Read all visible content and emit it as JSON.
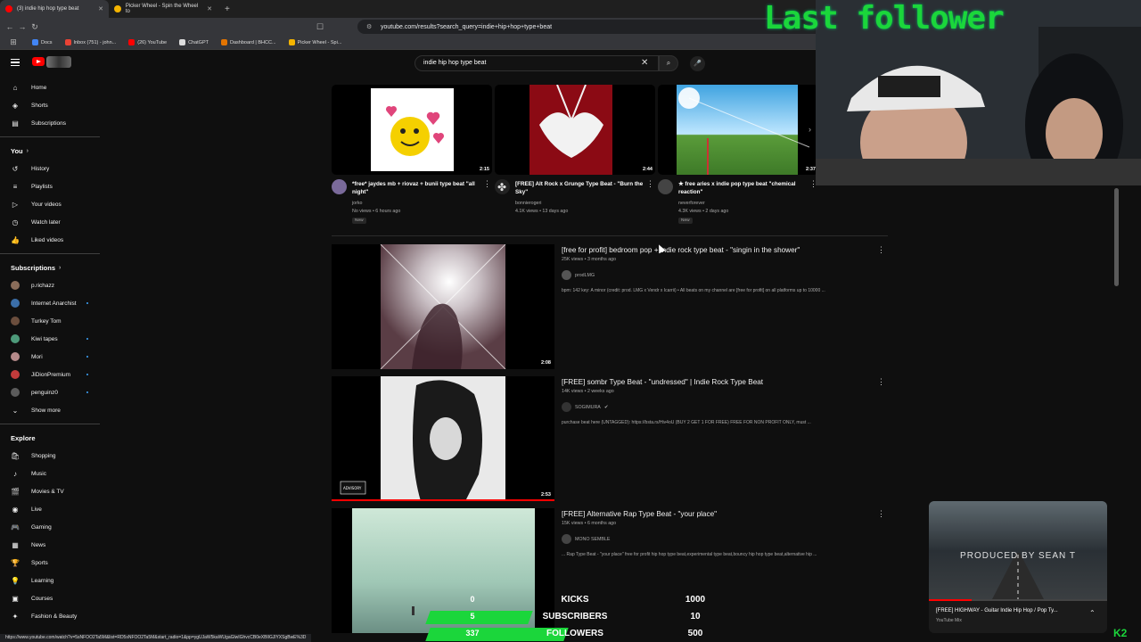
{
  "browser": {
    "tabs": [
      {
        "label": "(3) indie hip hop type beat",
        "color": "#ff0000"
      },
      {
        "label": "Picker Wheel - Spin the Wheel to",
        "color": "#f4b400"
      }
    ],
    "url": "youtube.com/results?search_query=indie+hip+hop+type+beat",
    "bookmarks": [
      "Docs",
      "Inbox (751) - john...",
      "(26) YouTube",
      "ChatGPT",
      "Dashboard | BHCC...",
      "Picker Wheel - Spi..."
    ]
  },
  "youtube": {
    "search_query": "indie hip hop type beat"
  },
  "sidebar": {
    "main": [
      {
        "label": "Home",
        "icon": "home-icon",
        "glyph": "⌂"
      },
      {
        "label": "Shorts",
        "icon": "shorts-icon",
        "glyph": "◈"
      },
      {
        "label": "Subscriptions",
        "icon": "subscriptions-icon",
        "glyph": "▤"
      }
    ],
    "you_heading": "You",
    "you": [
      {
        "label": "History",
        "icon": "history-icon",
        "glyph": "↺"
      },
      {
        "label": "Playlists",
        "icon": "playlists-icon",
        "glyph": "≡"
      },
      {
        "label": "Your videos",
        "icon": "your-videos-icon",
        "glyph": "▷"
      },
      {
        "label": "Watch later",
        "icon": "watch-later-icon",
        "glyph": "◷"
      },
      {
        "label": "Liked videos",
        "icon": "liked-videos-icon",
        "glyph": "👍"
      }
    ],
    "subs_heading": "Subscriptions",
    "subs": [
      {
        "label": "p.richazz",
        "color": "#8a6d5a",
        "dot": false
      },
      {
        "label": "Internet Anarchist",
        "color": "#3b6ea8",
        "dot": true
      },
      {
        "label": "Turkey Tom",
        "color": "#6b4e3d",
        "dot": false
      },
      {
        "label": "Kiwi tapes",
        "color": "#4d9a7a",
        "dot": true
      },
      {
        "label": "Mori",
        "color": "#b58a8a",
        "dot": true
      },
      {
        "label": "JiDionPremium",
        "color": "#c23b3b",
        "dot": true
      },
      {
        "label": "penguinz0",
        "color": "#5c5c5c",
        "dot": true
      }
    ],
    "show_more": "Show more",
    "explore_heading": "Explore",
    "explore": [
      {
        "label": "Shopping",
        "icon": "shopping-icon",
        "glyph": "🛍"
      },
      {
        "label": "Music",
        "icon": "music-icon",
        "glyph": "♪"
      },
      {
        "label": "Movies & TV",
        "icon": "movies-icon",
        "glyph": "🎬"
      },
      {
        "label": "Live",
        "icon": "live-icon",
        "glyph": "◉"
      },
      {
        "label": "Gaming",
        "icon": "gaming-icon",
        "glyph": "🎮"
      },
      {
        "label": "News",
        "icon": "news-icon",
        "glyph": "▦"
      },
      {
        "label": "Sports",
        "icon": "sports-icon",
        "glyph": "🏆"
      },
      {
        "label": "Learning",
        "icon": "learning-icon",
        "glyph": "💡"
      },
      {
        "label": "Courses",
        "icon": "courses-icon",
        "glyph": "▣"
      },
      {
        "label": "Fashion & Beauty",
        "icon": "fashion-icon",
        "glyph": "✦"
      }
    ]
  },
  "shorts": [
    {
      "title": "*free* jaydes mb + riovaz + bunii type beat \"all night\"",
      "channel": "jorko",
      "meta": "No views • 6 hours ago",
      "duration": "2:15",
      "badge": "New",
      "avatar": "#7a6a9a"
    },
    {
      "title": "[FREE] Alt Rock x Grunge Type Beat - \"Burn the Sky\"",
      "channel": "bonnierogeri",
      "meta": "4.1K views • 13 days ago",
      "duration": "2:44",
      "badge": "",
      "avatar": "#222222"
    },
    {
      "title": "★ free aries x indie pop type beat \"chemical reaction\"",
      "channel": "neverforever",
      "meta": "4.3K views • 2 days ago",
      "duration": "2:37",
      "badge": "New",
      "avatar": "#444444"
    }
  ],
  "videos": [
    {
      "title": "[free for profit] bedroom pop + indie rock type beat - \"singin in the shower\"",
      "meta": "25K views • 3 months ago",
      "channel": "prodLMG",
      "verified": false,
      "duration": "2:08",
      "desc": "bpm: 142 key: A minor (credit: prod. LMG x Vendr x Icarrii) • All beats on my channel are [free for profit] on all platforms up to 10000 ...",
      "avatar": "#555555"
    },
    {
      "title": "[FREE] sombr Type Beat - \"undressed\" | Indie Rock Type Beat",
      "meta": "14K views • 2 weeks ago",
      "channel": "SOGIMURA",
      "verified": true,
      "duration": "2:53",
      "desc": "purchase beat here (UNTAGGED): https://bsta.rs/Hiv4oU (BUY 2 GET 1 FOR FREE) FREE FOR NON PROFIT ONLY, must ...",
      "avatar": "#333333"
    },
    {
      "title": "[FREE] Alternative Rap Type Beat - \"your place\"",
      "meta": "15K views • 6 months ago",
      "channel": "MONO SEMBLE",
      "verified": false,
      "duration": "",
      "desc": "... Rap Type Beat - \"your place\" free for profit hip hop type beat,experimental type beat,bouncy hip hop type beat,alternative hip ...",
      "avatar": "#444444"
    }
  ],
  "overlay": {
    "title": "Last follower",
    "mini_player": {
      "overlay_text": "PRODUCED BY SEAN T",
      "title": "[FREE] HIGHWAY - Guitar Indie Hip Hop / Pop Ty...",
      "subtitle": "YouTube Mix",
      "progress": 0.24
    },
    "goals": [
      {
        "label": "KICKS",
        "current": "0",
        "goal": "1000",
        "progress": 0.0,
        "color": "#1bd63b"
      },
      {
        "label": "SUBSCRIBERS",
        "current": "5",
        "goal": "10",
        "progress": 0.5,
        "color": "#1bd63b"
      },
      {
        "label": "FOLLOWERS",
        "current": "337",
        "goal": "500",
        "progress": 0.674,
        "color": "#1bd63b"
      }
    ],
    "kick_badge": "K2"
  },
  "status_url": "https://www.youtube.com/watch?v=5sNFOO2Ta5M&list=RD5sNFOO2Ta5M&start_radio=1&pp=ygUJaW5kaWUgaGlwIGhvcCB0eXBlIGJlYXSgBwE%3D"
}
